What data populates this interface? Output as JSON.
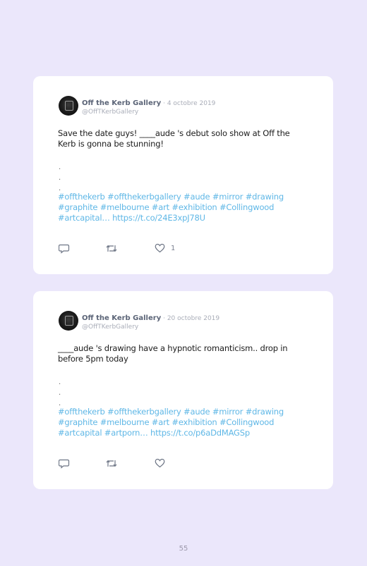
{
  "tweets": [
    {
      "name": "Off the Kerb Gallery",
      "separator": " · ",
      "date": "4 octobre 2019",
      "handle": "@OffTKerbGallery",
      "text_line1": "Save the date guys! ____aude 's debut solo show at Off the",
      "text_line2": "Kerb is gonna be stunning!",
      "dots": [
        ".",
        ".",
        "."
      ],
      "tags_line1": "#offthekerb #offthekerbgallery #aude #mirror #drawing",
      "tags_line2": "#graphite #melbourne #art #exhibition #Collingwood",
      "tags_line3": "#artcapital… https://t.co/24E3xpJ78U",
      "like_count": "1"
    },
    {
      "name": "Off the Kerb Gallery",
      "separator": " · ",
      "date": "20 octobre 2019",
      "handle": "@OffTKerbGallery",
      "text_line1": "____aude 's drawing have a hypnotic romanticism.. drop in",
      "text_line2": "before 5pm today",
      "dots": [
        ".",
        ".",
        "."
      ],
      "tags_line1": "#offthekerb #offthekerbgallery #aude #mirror #drawing",
      "tags_line2": "#graphite #melbourne #art #exhibition #Collingwood",
      "tags_line3": "#artcapital #artporn… https://t.co/p6aDdMAGSp",
      "like_count": ""
    }
  ],
  "page_number": "55",
  "colors": {
    "background": "#ebe7fb",
    "card": "#ffffff",
    "hashtag": "#5fb7e6",
    "name": "#5b6477",
    "meta": "#a9adb8"
  },
  "icons": [
    "reply-icon",
    "retweet-icon",
    "like-icon"
  ]
}
